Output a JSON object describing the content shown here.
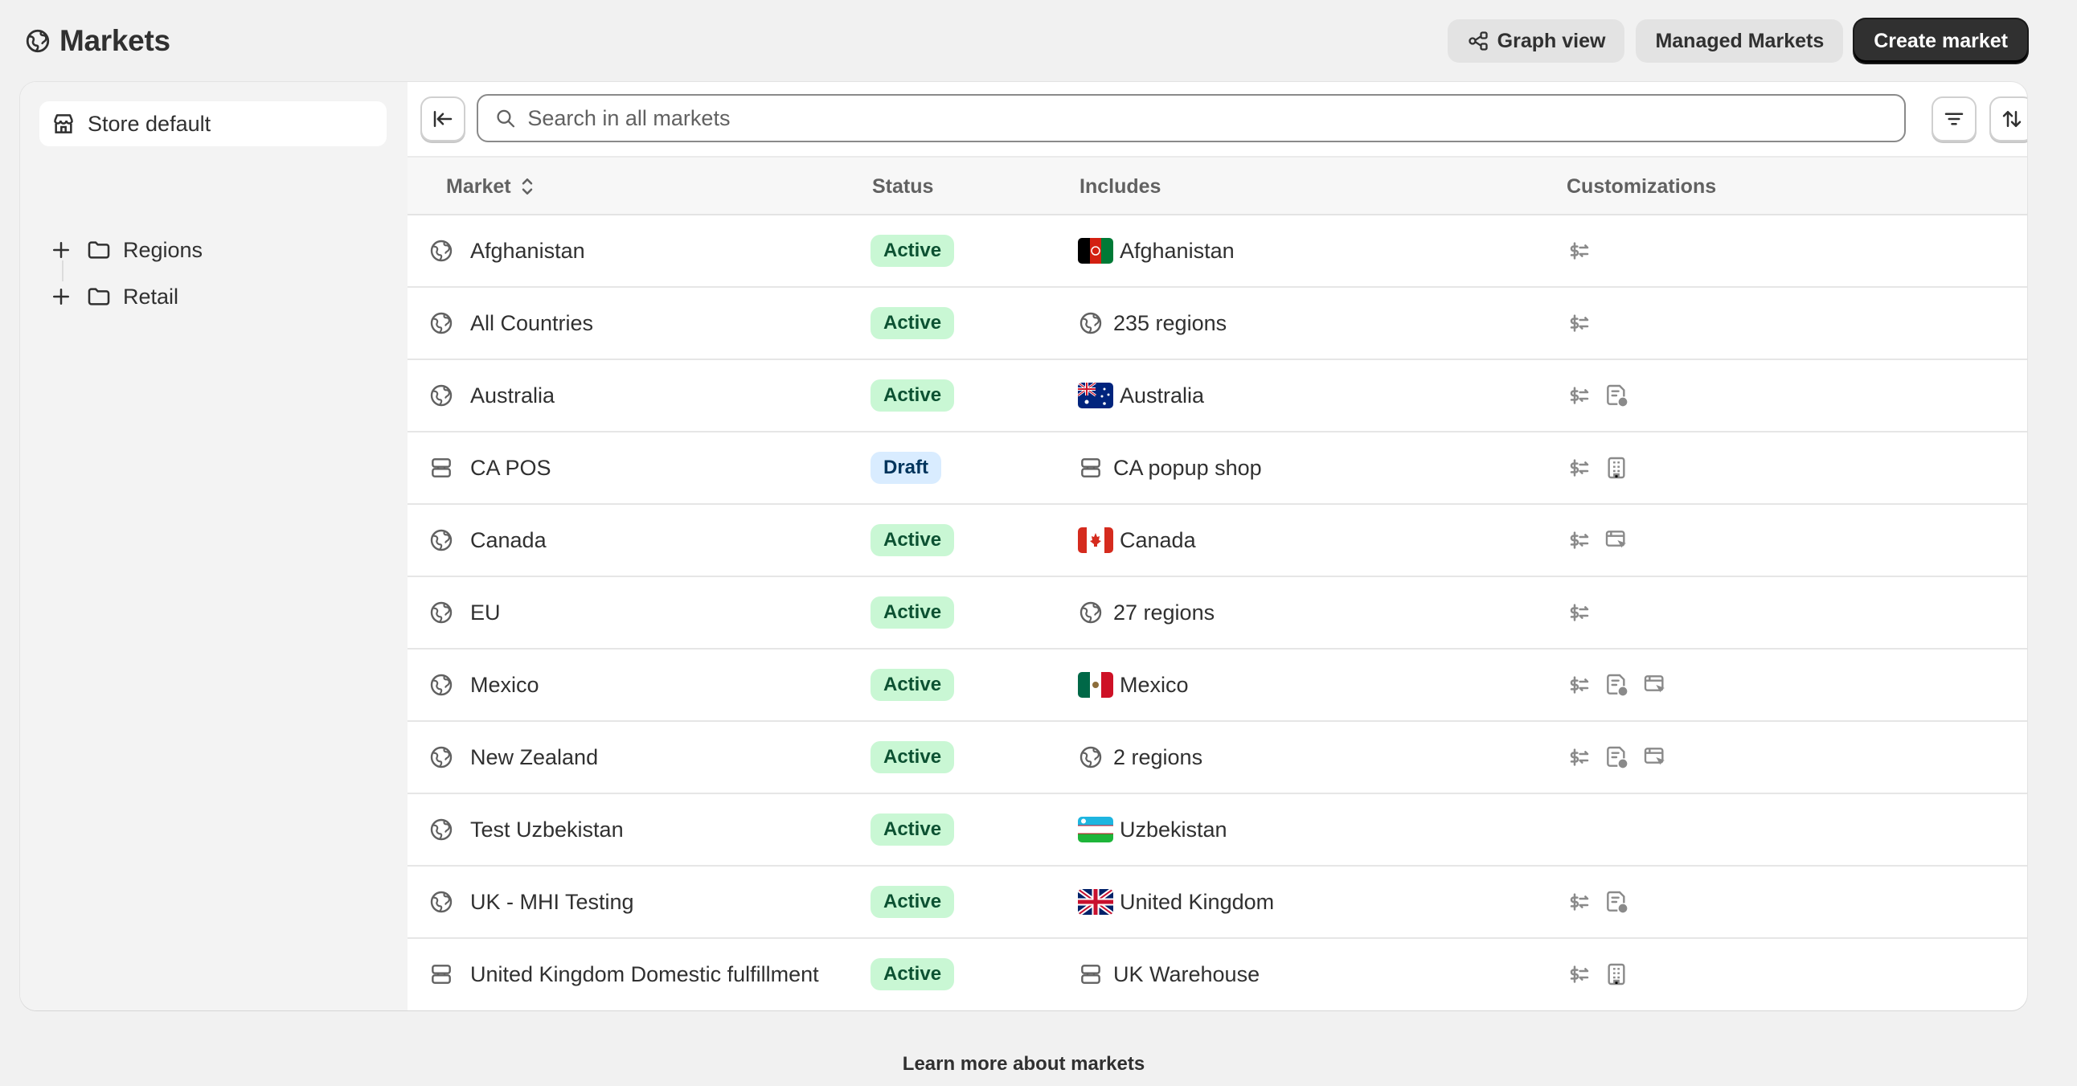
{
  "header": {
    "title": "Markets",
    "buttons": {
      "graph_view": "Graph view",
      "managed_markets": "Managed Markets",
      "create_market": "Create market"
    }
  },
  "sidebar": {
    "selected": "Store default",
    "folders": [
      {
        "label": "Regions"
      },
      {
        "label": "Retail"
      }
    ]
  },
  "search": {
    "placeholder": "Search in all markets",
    "value": ""
  },
  "table": {
    "columns": {
      "market": "Market",
      "status": "Status",
      "includes": "Includes",
      "customizations": "Customizations"
    },
    "rows": [
      {
        "market": "Afghanistan",
        "market_icon": "globe-icon",
        "status": "Active",
        "includes": "Afghanistan",
        "includes_icon": "flag-af",
        "custom": [
          "currency-icon"
        ]
      },
      {
        "market": "All Countries",
        "market_icon": "globe-icon",
        "status": "Active",
        "includes": "235 regions",
        "includes_icon": "globe-icon",
        "custom": [
          "currency-icon"
        ]
      },
      {
        "market": "Australia",
        "market_icon": "globe-icon",
        "status": "Active",
        "includes": "Australia",
        "includes_icon": "flag-au",
        "custom": [
          "currency-icon",
          "catalog-icon"
        ]
      },
      {
        "market": "CA POS",
        "market_icon": "pos-icon",
        "status": "Draft",
        "includes": "CA popup shop",
        "includes_icon": "pos-icon",
        "custom": [
          "currency-icon",
          "building-icon"
        ]
      },
      {
        "market": "Canada",
        "market_icon": "globe-icon",
        "status": "Active",
        "includes": "Canada",
        "includes_icon": "flag-ca",
        "custom": [
          "currency-icon",
          "storefront-icon"
        ]
      },
      {
        "market": "EU",
        "market_icon": "globe-icon",
        "status": "Active",
        "includes": "27 regions",
        "includes_icon": "globe-icon",
        "custom": [
          "currency-icon"
        ]
      },
      {
        "market": "Mexico",
        "market_icon": "globe-icon",
        "status": "Active",
        "includes": "Mexico",
        "includes_icon": "flag-mx",
        "custom": [
          "currency-icon",
          "catalog-icon",
          "storefront-icon"
        ]
      },
      {
        "market": "New Zealand",
        "market_icon": "globe-icon",
        "status": "Active",
        "includes": "2 regions",
        "includes_icon": "globe-icon",
        "custom": [
          "currency-icon",
          "catalog-icon",
          "storefront-icon"
        ]
      },
      {
        "market": "Test Uzbekistan",
        "market_icon": "globe-icon",
        "status": "Active",
        "includes": "Uzbekistan",
        "includes_icon": "flag-uz",
        "custom": []
      },
      {
        "market": "UK - MHI Testing",
        "market_icon": "globe-icon",
        "status": "Active",
        "includes": "United Kingdom",
        "includes_icon": "flag-gb",
        "custom": [
          "currency-icon",
          "catalog-icon"
        ]
      },
      {
        "market": "United Kingdom Domestic fulfillment",
        "market_icon": "pos-icon",
        "status": "Active",
        "includes": "UK Warehouse",
        "includes_icon": "pos-icon",
        "custom": [
          "currency-icon",
          "building-icon"
        ]
      }
    ]
  },
  "footer": {
    "link": "Learn more about markets"
  },
  "colors": {
    "active_badge_bg": "#c9f7d4",
    "active_badge_text": "#0c5132",
    "draft_badge_bg": "#d9ecff",
    "draft_badge_text": "#00345c",
    "primary_button": "#303030"
  }
}
